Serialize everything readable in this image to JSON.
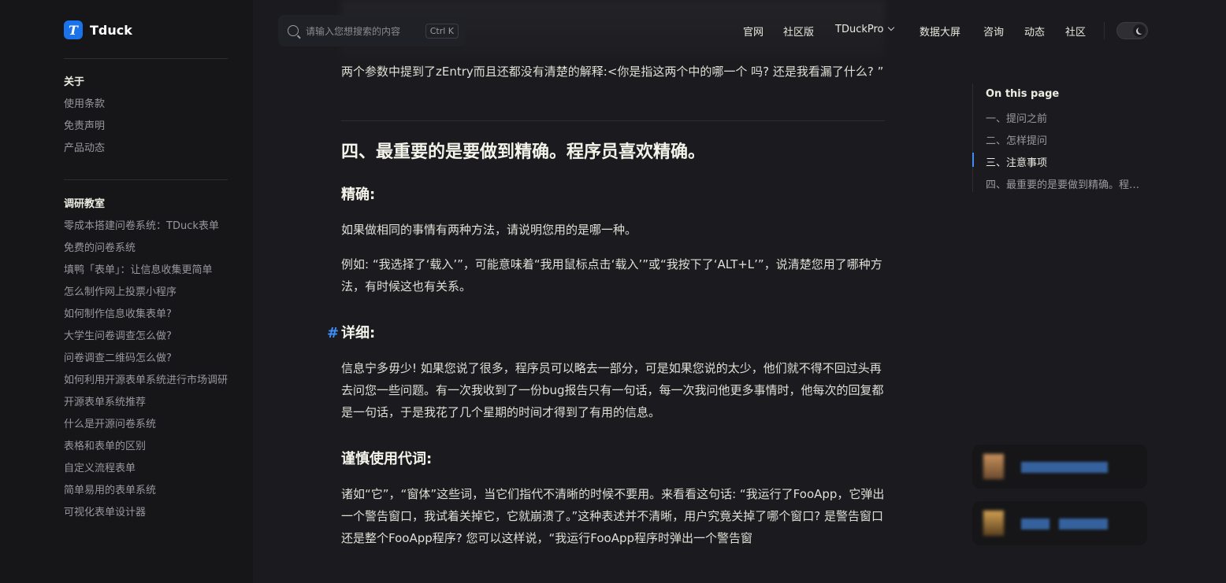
{
  "brand": {
    "name": "Tduck",
    "logo_letter": "T"
  },
  "search": {
    "placeholder": "请输入您想搜索的内容",
    "shortcut": "Ctrl K"
  },
  "topnav": {
    "items": [
      "官网",
      "社区版",
      "TDuckPro",
      "数据大屏",
      "咨询",
      "动态",
      "社区"
    ]
  },
  "sidebar": {
    "groups": [
      {
        "title": "关于",
        "items": [
          "使用条款",
          "免责声明",
          "产品动态"
        ]
      },
      {
        "title": "调研教室",
        "items": [
          "零成本搭建问卷系统：TDuck表单",
          "免费的问卷系统",
          "填鸭「表单」：让信息收集更简单",
          "怎么制作网上投票小程序",
          "如何制作信息收集表单?",
          "大学生问卷调查怎么做?",
          "问卷调查二维码怎么做?",
          "如何利用开源表单系统进行市场调研",
          "开源表单系统推荐",
          "什么是开源问卷系统",
          "表格和表单的区别",
          "自定义流程表单",
          "简单易用的表单系统",
          "可视化表单设计器"
        ]
      }
    ]
  },
  "content": {
    "p_top": "两个参数中提到了zEntry而且还都没有清楚的解释:<你是指这两个中的哪一个 吗? 还是我看漏了什么? ”",
    "h2": "四、最重要的是要做到精确。程序员喜欢精确。",
    "h3_precise": "精确:",
    "p_precise_1": "如果做相同的事情有两种方法，请说明您用的是哪一种。",
    "p_precise_2": "例如: “我选择了‘载入’”，可能意味着“我用鼠标点击‘载入’”或“我按下了‘ALT+L’”，说清楚您用了哪种方法，有时候这也有关系。",
    "anchor": "#",
    "h3_detail": "详细:",
    "p_detail": "信息宁多毋少! 如果您说了很多，程序员可以略去一部分，可是如果您说的太少，他们就不得不回过头再去问您一些问题。有一次我收到了一份bug报告只有一句话，每一次我问他更多事情时，他每次的回复都是一句话，于是我花了几个星期的时间才得到了有用的信息。",
    "h3_pronoun": "谨慎使用代词:",
    "p_pronoun": "诸如“它”，“窗体”这些词，当它们指代不清晰的时候不要用。来看看这句话: “我运行了FooApp，它弹出一个警告窗口，我试着关掉它，它就崩溃了。”这种表述并不清晰，用户究竟关掉了哪个窗口? 是警告窗口还是整个FooApp程序? 您可以这样说，“我运行FooApp程序时弹出一个警告窗"
  },
  "outline": {
    "title": "On this page",
    "items": [
      "一、提问之前",
      "二、怎样提问",
      "三、注意事项",
      "四、最重要的是要做到精确。程序员喜欢精确。"
    ],
    "active_index": 2
  },
  "colors": {
    "accent": "#3e8ef7",
    "logo_bg": "#1a73e8",
    "background": "#1b1b1f",
    "sidebar_bg": "#161618"
  }
}
